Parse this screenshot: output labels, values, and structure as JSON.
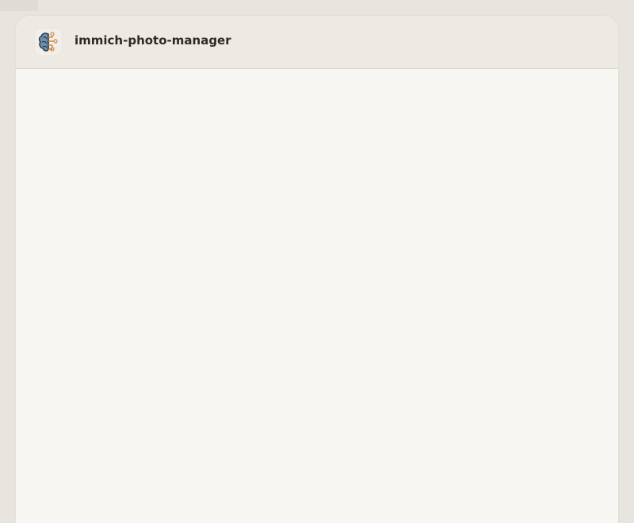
{
  "app": {
    "title": "immich-photo-manager",
    "icon": "brain-circuit-icon"
  },
  "colors": {
    "background": "#e8e4de",
    "header": "#eee9e3",
    "content": "#f8f6f2",
    "title_text": "#2d2a26",
    "icon_accent": "#d08a42",
    "icon_dark": "#233548"
  }
}
